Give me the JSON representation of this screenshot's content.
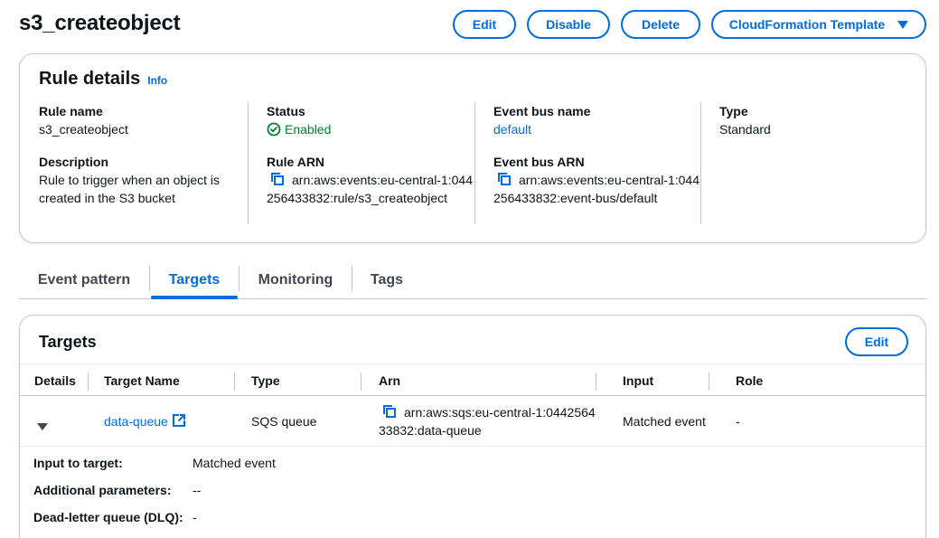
{
  "page": {
    "title": "s3_createobject"
  },
  "header_actions": {
    "edit": "Edit",
    "disable": "Disable",
    "delete": "Delete",
    "cloudformation": "CloudFormation Template"
  },
  "rule_details": {
    "heading": "Rule details",
    "info": "Info",
    "rule_name_label": "Rule name",
    "rule_name_value": "s3_createobject",
    "description_label": "Description",
    "description_value": "Rule to trigger when an object is created in the S3 bucket",
    "status_label": "Status",
    "status_value": "Enabled",
    "rule_arn_label": "Rule ARN",
    "rule_arn_value": "arn:aws:events:eu-central-1:044256433832:rule/s3_createobject",
    "event_bus_name_label": "Event bus name",
    "event_bus_name_value": "default",
    "event_bus_arn_label": "Event bus ARN",
    "event_bus_arn_value": "arn:aws:events:eu-central-1:044256433832:event-bus/default",
    "type_label": "Type",
    "type_value": "Standard"
  },
  "tabs": [
    "Event pattern",
    "Targets",
    "Monitoring",
    "Tags"
  ],
  "active_tab": "Targets",
  "targets": {
    "title": "Targets",
    "edit": "Edit",
    "columns": [
      "Details",
      "Target Name",
      "Type",
      "Arn",
      "Input",
      "Role"
    ],
    "rows": [
      {
        "target_name": "data-queue",
        "type": "SQS queue",
        "arn": "arn:aws:sqs:eu-central-1:044256433832:data-queue",
        "input": "Matched event",
        "role": "-"
      }
    ],
    "details": {
      "input_to_target_label": "Input to target:",
      "input_to_target_value": "Matched event",
      "additional_parameters_label": "Additional parameters:",
      "additional_parameters_value": "--",
      "dlq_label": "Dead-letter queue (DLQ):",
      "dlq_value": "-"
    }
  },
  "colors": {
    "accent": "#006ce0",
    "success": "#00802f",
    "border": "#c6c6cd"
  },
  "icons": [
    "copy-icon",
    "check-circle-icon",
    "external-link-icon",
    "caret-down-icon"
  ]
}
